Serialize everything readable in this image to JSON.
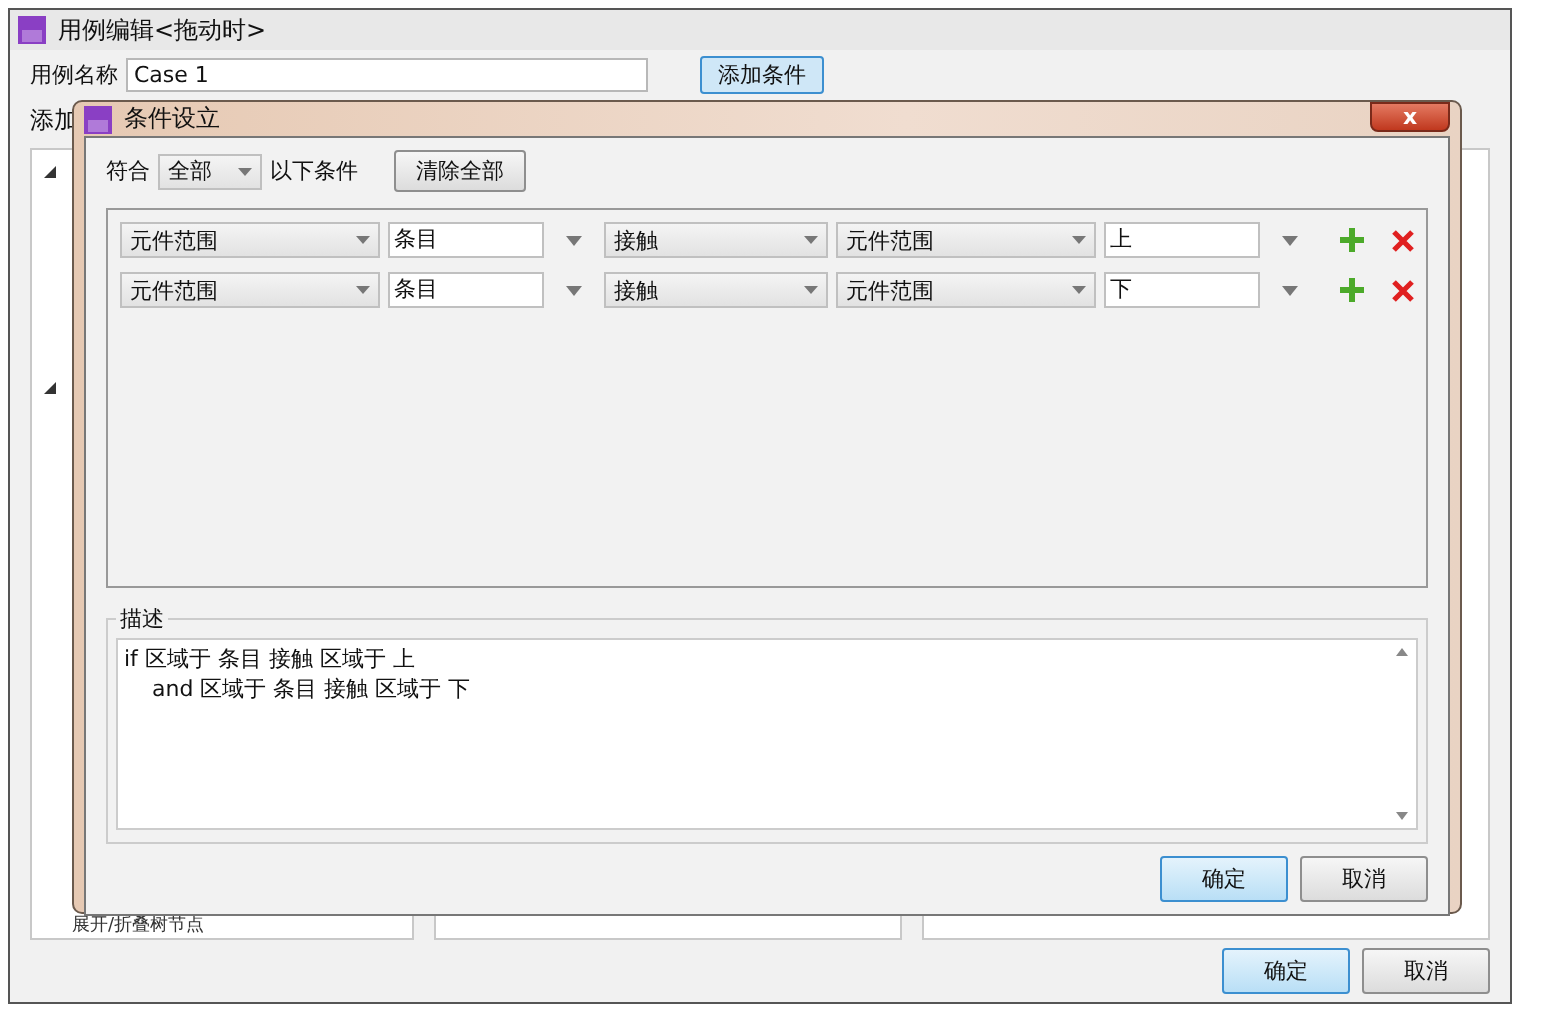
{
  "window": {
    "title": "用例编辑<拖动时>",
    "case_name_label": "用例名称",
    "case_name_value": "Case 1",
    "add_condition_button": "添加条件",
    "add_label": "添加",
    "tree_item": "展开/折叠树节点",
    "ok_button": "确定",
    "cancel_button": "取消"
  },
  "dialog": {
    "title": "条件设立",
    "close_icon": "x",
    "match_label": "符合",
    "match_value": "全部",
    "match_suffix": "以下条件",
    "clear_button": "清除全部",
    "conditions": [
      {
        "fields": [
          {
            "kind": "select",
            "value": "元件范围"
          },
          {
            "kind": "combo",
            "value": "条目"
          },
          {
            "kind": "select",
            "value": "接触"
          },
          {
            "kind": "select",
            "value": "元件范围"
          },
          {
            "kind": "combo",
            "value": "上"
          }
        ]
      },
      {
        "fields": [
          {
            "kind": "select",
            "value": "元件范围"
          },
          {
            "kind": "combo",
            "value": "条目"
          },
          {
            "kind": "select",
            "value": "接触"
          },
          {
            "kind": "select",
            "value": "元件范围"
          },
          {
            "kind": "combo",
            "value": "下"
          }
        ]
      }
    ],
    "description_label": "描述",
    "description_lines": [
      "if 区域于 条目 接触 区域于 上",
      "    and 区域于 条目 接触 区域于 下"
    ],
    "ok_button": "确定",
    "cancel_button": "取消"
  }
}
